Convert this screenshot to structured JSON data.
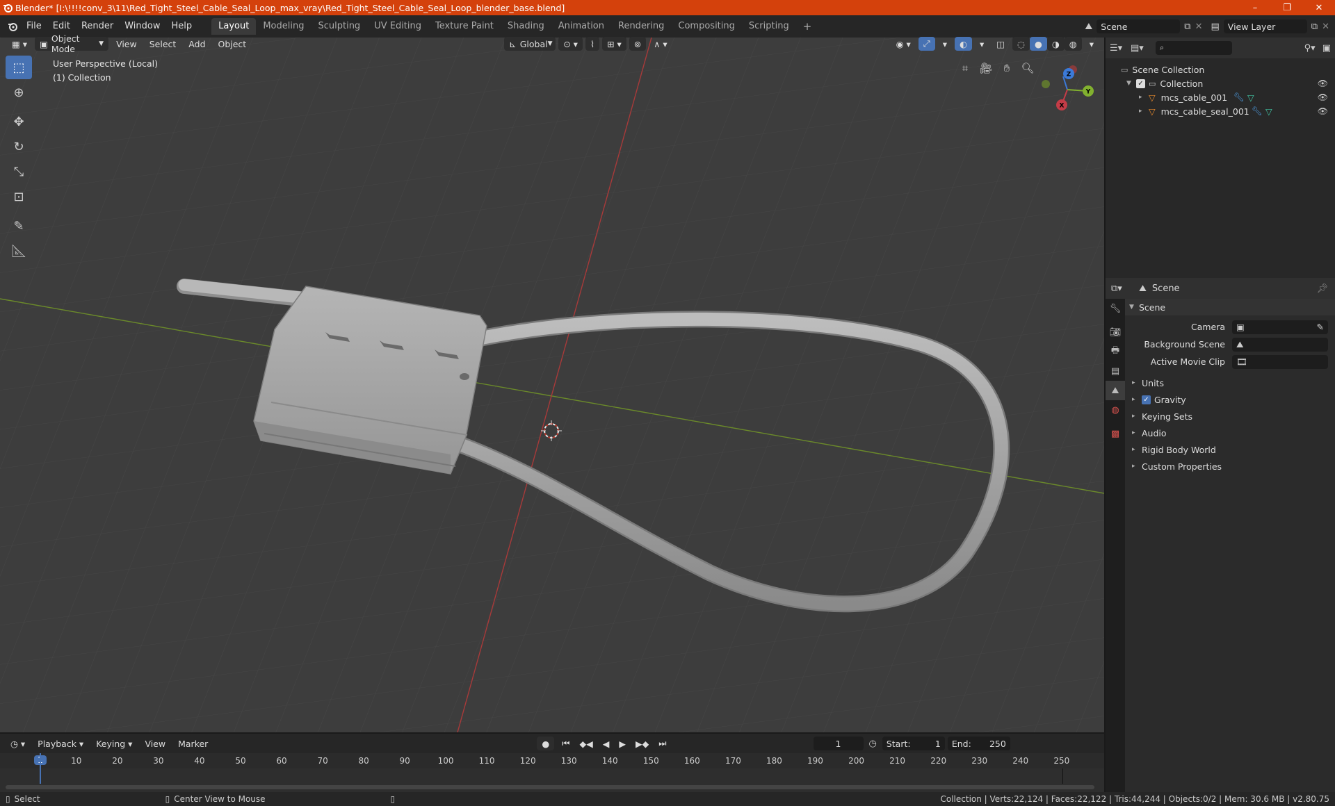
{
  "titlebar": {
    "title": "Blender* [I:\\!!!!conv_3\\11\\Red_Tight_Steel_Cable_Seal_Loop_max_vray\\Red_Tight_Steel_Cable_Seal_Loop_blender_base.blend]",
    "minimize": "–",
    "maximize": "❐",
    "close": "✕"
  },
  "menu": [
    "File",
    "Edit",
    "Render",
    "Window",
    "Help"
  ],
  "workspaces": [
    "Layout",
    "Modeling",
    "Sculpting",
    "UV Editing",
    "Texture Paint",
    "Shading",
    "Animation",
    "Rendering",
    "Compositing",
    "Scripting"
  ],
  "active_workspace": "Layout",
  "scene_field": "Scene",
  "view_layer_field": "View Layer",
  "viewport_header": {
    "mode": "Object Mode",
    "view": "View",
    "select": "Select",
    "add": "Add",
    "object": "Object",
    "orientation": "Global"
  },
  "viewport_overlay": {
    "perspective": "User Perspective (Local)",
    "collection": "(1) Collection"
  },
  "gizmo": {
    "x": "X",
    "y": "Y",
    "z": "Z"
  },
  "outliner": {
    "root": "Scene Collection",
    "collection": "Collection",
    "items": [
      "mcs_cable_001",
      "mcs_cable_seal_001"
    ]
  },
  "properties": {
    "header": "Scene",
    "section": "Scene",
    "camera_label": "Camera",
    "background_scene_label": "Background Scene",
    "active_movie_clip_label": "Active Movie Clip",
    "panels": [
      "Units",
      "Gravity",
      "Keying Sets",
      "Audio",
      "Rigid Body World",
      "Custom Properties"
    ]
  },
  "timeline": {
    "playback": "Playback",
    "keying": "Keying",
    "view": "View",
    "marker": "Marker",
    "current_frame": "1",
    "start_label": "Start:",
    "start": "1",
    "end_label": "End:",
    "end": "250",
    "ticks": [
      "1",
      "10",
      "20",
      "30",
      "40",
      "50",
      "60",
      "70",
      "80",
      "90",
      "100",
      "110",
      "120",
      "130",
      "140",
      "150",
      "160",
      "170",
      "180",
      "190",
      "200",
      "210",
      "220",
      "230",
      "240",
      "250"
    ]
  },
  "statusbar": {
    "select": "Select",
    "center": "Center View to Mouse",
    "stats": "Collection | Verts:22,124 | Faces:22,122 | Tris:44,244 | Objects:0/2 | Mem: 30.6 MB | v2.80.75"
  },
  "colors": {
    "titlebar": "#d4410c",
    "accent": "#4772b3",
    "x_axis": "#c43c47",
    "y_axis": "#82b12f",
    "z_axis": "#3b7ad8"
  }
}
